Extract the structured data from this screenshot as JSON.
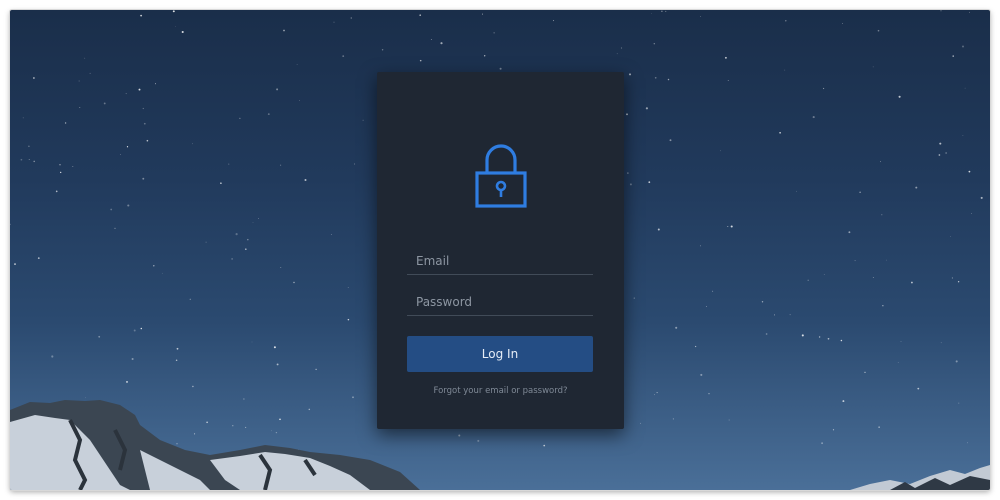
{
  "login": {
    "email_placeholder": "Email",
    "password_placeholder": "Password",
    "submit_label": "Log In",
    "forgot_label": "Forgot your email or password?"
  },
  "icons": {
    "lock": "lock-icon"
  },
  "colors": {
    "accent": "#2f7de1",
    "button": "#244d84",
    "card": "#1f2733",
    "sky_top": "#1a2e4a",
    "sky_bottom": "#4a6f98"
  }
}
